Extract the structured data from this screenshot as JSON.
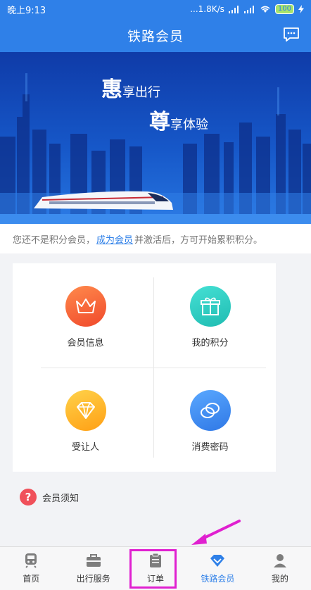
{
  "status_bar": {
    "time": "晚上9:13",
    "speed": "...1.8K/s",
    "battery": "100"
  },
  "header": {
    "title": "铁路会员"
  },
  "banner": {
    "slogan1_big": "惠",
    "slogan1_rest": "享出行",
    "slogan2_big": "尊",
    "slogan2_rest": "享体验"
  },
  "notice": {
    "before": "您还不是积分会员，",
    "link": "成为会员",
    "after": "并激活后，方可开始累积积分。"
  },
  "grid": {
    "items": [
      {
        "label": "会员信息",
        "icon": "crown-icon",
        "color": "#f5633a"
      },
      {
        "label": "我的积分",
        "icon": "gift-icon",
        "color": "#2fd0c4"
      },
      {
        "label": "受让人",
        "icon": "diamond-icon",
        "color": "#ffb51e"
      },
      {
        "label": "消费密码",
        "icon": "coins-icon",
        "color": "#3f8ef2"
      }
    ]
  },
  "help": {
    "label": "会员须知",
    "icon_text": "?"
  },
  "tabbar": {
    "tabs": [
      {
        "label": "首页",
        "icon": "train-icon"
      },
      {
        "label": "出行服务",
        "icon": "briefcase-icon"
      },
      {
        "label": "订单",
        "icon": "clipboard-icon"
      },
      {
        "label": "铁路会员",
        "icon": "diamond-icon",
        "active": true
      },
      {
        "label": "我的",
        "icon": "user-icon"
      }
    ]
  },
  "colors": {
    "brand": "#2f80e8",
    "annotation": "#e020d0"
  }
}
